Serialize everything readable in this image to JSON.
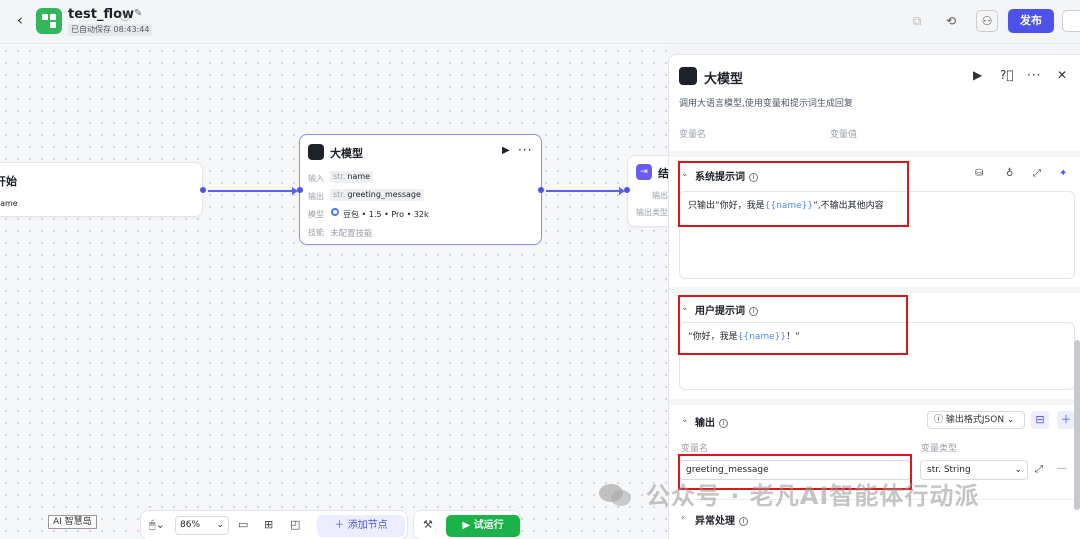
{
  "topbar": {
    "title": "test_flow",
    "autosave": "已自动保存 08:43:44",
    "publish_label": "发布"
  },
  "canvas": {
    "start_node": {
      "title": "开始",
      "output_var": "name"
    },
    "llm_node": {
      "title": "大模型",
      "input_label": "输入",
      "input_type": "str.",
      "input_var": "name",
      "output_label": "输出",
      "output_type": "str.",
      "output_var": "greeting_message",
      "model_label": "模型",
      "model_value": "豆包 • 1.5 • Pro • 32k",
      "skill_label": "技能",
      "skill_value": "未配置技能"
    },
    "end_node": {
      "title": "结",
      "output_label": "输出",
      "output_type_label": "输出类型"
    }
  },
  "bottom_toolbar": {
    "ai_tag": "AI 智慧岛",
    "zoom": "86%",
    "add_node_label": "添加节点",
    "run_label": "试运行"
  },
  "panel": {
    "title": "大模型",
    "description": "调用大语言模型,使用变量和提示词生成回复",
    "var_name_col": "变量名",
    "var_value_col": "变量值",
    "system_prompt": {
      "title": "系统提示词",
      "text_before": "只输出“你好，我是",
      "var": "{{name}}",
      "text_after": "”,不输出其他内容"
    },
    "user_prompt": {
      "title": "用户提示词",
      "text_before": "“你好，我是",
      "var": "{{name}}",
      "text_after": "！”"
    },
    "output": {
      "title": "输出",
      "format_label": "输出格式JSON",
      "var_name_col": "变量名",
      "var_type_col": "变量类型",
      "var_name": "greeting_message",
      "var_type": "str. String"
    },
    "exception": {
      "title": "异常处理"
    }
  },
  "watermark": "公众号 · 老凡AI智能体行动派",
  "colors": {
    "accent": "#4d53e8",
    "run_green": "#19b34a",
    "highlight_red": "#e0151a",
    "variable_blue": "#4d8cf5"
  }
}
